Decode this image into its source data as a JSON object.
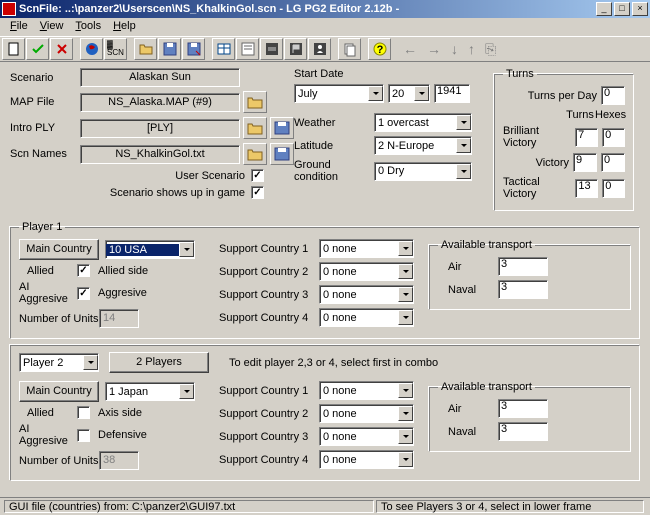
{
  "window": {
    "title_prefix": "ScnFile: ..:\\panzer2\\Userscen\\NS_KhalkinGol.scn",
    "app_title": "  - LG PG2 Editor 2.12b -"
  },
  "menu": {
    "file": "File",
    "view": "View",
    "tools": "Tools",
    "help": "Help"
  },
  "scenario": {
    "label_scenario": "Scenario",
    "scenario_name": "Alaskan Sun",
    "label_map": "MAP  File",
    "map_file": "NS_Alaska.MAP (#9)",
    "label_ply": "Intro PLY",
    "ply": "[PLY]",
    "label_scn": "Scn Names",
    "scn_txt": "NS_KhalkinGol.txt",
    "label_user": "User Scenario",
    "user_checked": true,
    "label_shows": "Scenario shows up in game",
    "shows_checked": true
  },
  "date": {
    "label": "Start Date",
    "month": "July",
    "day": "20",
    "year": "1941",
    "label_weather": "Weather",
    "weather": "1  overcast",
    "label_lat": "Latitude",
    "latitude": "2  N-Europe",
    "label_ground": "Ground condition",
    "ground": "0  Dry"
  },
  "turns": {
    "legend": "Turns",
    "label_tpd": "Turns per Day",
    "tpd": "0",
    "hdr_turns": "Turns",
    "hdr_hexes": "Hexes",
    "label_bv": "Brilliant Victory",
    "bv_turns": "7",
    "bv_hex": "0",
    "label_v": "Victory",
    "v_turns": "9",
    "v_hex": "0",
    "label_tv": "Tactical Victory",
    "tv_turns": "13",
    "tv_hex": "0"
  },
  "player1": {
    "legend": "Player 1",
    "label_main": "Main Country",
    "main": "10 USA",
    "allied_lbl": "Allied",
    "allied_checked": true,
    "allied_side": "Allied side",
    "ai_lbl": "AI Aggresive",
    "ai_checked": true,
    "ai_desc": "Aggresive",
    "units_lbl": "Number of Units",
    "units": "14",
    "sc1_lbl": "Support  Country 1",
    "sc1": "0 none",
    "sc2_lbl": "Support  Country 2",
    "sc2": "0 none",
    "sc3_lbl": "Support  Country 3",
    "sc3": "0 none",
    "sc4_lbl": "Support  Country 4",
    "sc4": "0 none",
    "transport_legend": "Available transport",
    "air_lbl": "Air",
    "air": "3",
    "naval_lbl": "Naval",
    "naval": "3"
  },
  "player_nav": {
    "sel": "Player  2",
    "btn": "2 Players",
    "hint": "To edit player 2,3 or 4, select first in combo"
  },
  "player2": {
    "label_main": "Main Country",
    "main": "1 Japan",
    "allied_lbl": "Allied",
    "allied_checked": false,
    "allied_side": "Axis side",
    "ai_lbl": "AI Aggresive",
    "ai_checked": false,
    "ai_desc": "Defensive",
    "units_lbl": "Number of Units",
    "units": "38",
    "sc1_lbl": "Support  Country 1",
    "sc1": "0 none",
    "sc2_lbl": "Support  Country 2",
    "sc2": "0 none",
    "sc3_lbl": "Support  Country 3",
    "sc3": "0 none",
    "sc4_lbl": "Support  Country 4",
    "sc4": "0 none",
    "transport_legend": "Available transport",
    "air_lbl": "Air",
    "air": "3",
    "naval_lbl": "Naval",
    "naval": "3"
  },
  "status": {
    "left": "GUI file (countries) from: C:\\panzer2\\GUI97.txt",
    "right": "To see Players 3 or 4, select in lower frame"
  }
}
